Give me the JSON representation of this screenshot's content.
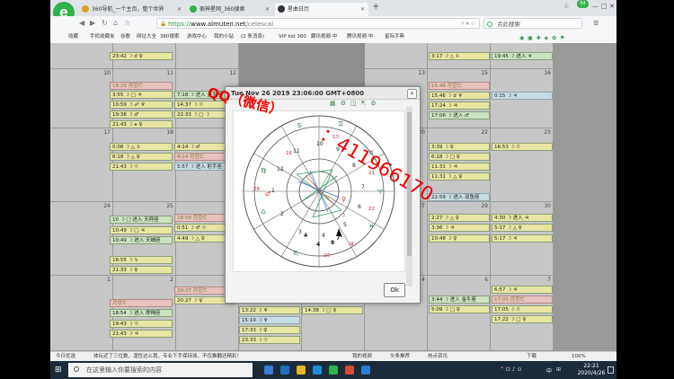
{
  "browser": {
    "tabs": [
      {
        "title": "360导航_一个主页，整个世界",
        "icon_color": "#d8a21a"
      },
      {
        "title": "宿神星网_360搜索",
        "icon_color": "#2fb24a"
      },
      {
        "title": "星曲日历",
        "icon_color": "#333333"
      }
    ],
    "profile_badge": "54",
    "url_prefix": "https://",
    "url_host": "www.almuten.net",
    "url_path": "/celescal",
    "search_placeholder": "点此搜索",
    "bookmarks": [
      "收藏",
      "手机收藏夹",
      "谷歌",
      "网址大全",
      "360搜索",
      "游戏中心",
      "我的小站",
      "(2 条消息)",
      "VIP kid 360",
      "翻讯视频·中",
      "腾讯视频·中",
      "星际字典"
    ]
  },
  "calendar": {
    "day_numbers": [
      "10",
      "11",
      "12",
      "13",
      "14",
      "15",
      "16",
      "17",
      "18",
      "19",
      "20",
      "21",
      "22",
      "23",
      "24",
      "25",
      "26",
      "27",
      "28",
      "29",
      "30",
      "1",
      "2",
      "3",
      "4",
      "5",
      "6",
      "7"
    ],
    "col0": [
      "23:42 ☽ ☌ ♀",
      "18:23 月空亡",
      "3:55 ☽ □ ♃",
      "10:59 ☽ ☍ ♆",
      "19:38 ☽ ♂",
      "21:43 ☽ ⚹ ♀",
      "0:08 ☽ △ ♄",
      "6:18 ☽ △ ♀",
      "21:43 ☽ ☉",
      "10 ☽ □ 进入 天秤座",
      "10:49 ☽ □ ♃",
      "10:49 ☽ 进入 天蝎座",
      "18:55 ☽ ♄",
      "21:33 ☽ ♀",
      "月空亡",
      "18:54 ☽ 进入 摩羯座",
      "19:43 ☽ ☉",
      "21:43 ☽ ♃"
    ],
    "col1": [
      "7:18 ☽ 进入 金牛座",
      "14:37 ☽ ☉",
      "22:33 ☽ □ ☽",
      "4:14 ☽ ♂",
      "4:14 月空亡",
      "5:57 ☽ 进入 射手座",
      "18:59 月空亡",
      "0:51 ☽ ♂ ☉",
      "4:49 ☽ △ ♀",
      "20:27 月空亡",
      "20:27 ☽ ♀"
    ],
    "col2": [
      "13:22 ☽ ♆",
      "15:10 ☽ ♆",
      "17:33 ☽ ♀",
      "23:33 ☽ ☉",
      "14:38 ☽ □ ♀"
    ],
    "col6": [
      "3:17 ☽ △ ♄",
      "15:46 月空亡",
      "15:46 ☽ ☌ ♆",
      "17:24 ☽ ♃",
      "17:06 ☽ 进入 ♂",
      "3:39 ☽ ♀",
      "6:18 ☽ □ ♀",
      "11:31 ☽ ♃",
      "11:31 ☽ △ ♀",
      "22:59 ☽ 进入 双鱼座",
      "2:27 ☽ △ ♀",
      "3:36 ☽ ♃",
      "10:48 ☽ ♀",
      "3:44 ☽ 进入 金牛座",
      "5:09 ☽ □ ♀"
    ],
    "col7": [
      "19:45 ☽ 进入 ♃",
      "0:15 ☽ ♃",
      "16:53 ☽ ☉",
      "4:30 ☽ 进入 ♃",
      "5:17 ☽ △ ♀",
      "5:17 ☽ ♃",
      "6:57 ☽ ♃",
      "17:05 月空亡",
      "17:05 ☽ ☉",
      "17:22 ☽ □ ♀"
    ]
  },
  "dialog": {
    "title": "Tue Nov 26 2019 23:06:00 GMT+0800",
    "ok_label": "Ok",
    "tool_icons": [
      "chart-icon",
      "settings-icon",
      "share-icon",
      "export-icon",
      "gear-icon"
    ]
  },
  "chart_labels": {
    "house_numbers": [
      "1",
      "2",
      "3",
      "4",
      "5",
      "6",
      "7",
      "8",
      "9",
      "10",
      "11",
      "12"
    ],
    "degrees": [
      "28",
      "16",
      "13",
      "21",
      "22",
      "20",
      "4",
      "4",
      "8"
    ]
  },
  "watermark": {
    "line1": "QQ（微信）",
    "line2": "：411966170"
  },
  "statusbar": {
    "items": [
      "今日优选",
      "体坛近了三位数，湿性达么我，专业下手保持球，不仅推翻还精彩！",
      "我的视频",
      "头条推荐",
      "热点资讯",
      "下载",
      "100%"
    ]
  },
  "taskbar": {
    "search_placeholder": "在这里输入你要搜索的内容",
    "ime": "中",
    "time": "22:21",
    "date": "2020/4/26"
  }
}
